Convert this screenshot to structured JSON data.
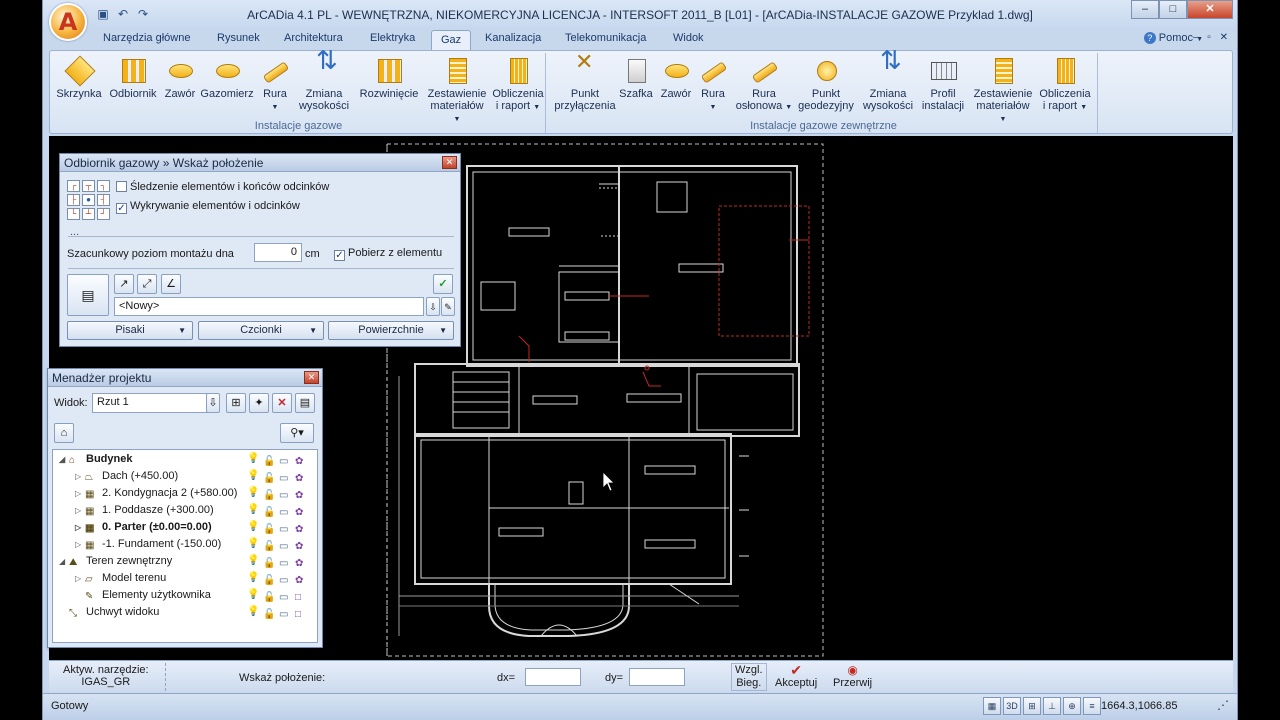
{
  "window": {
    "title": "ArCADia 4.1 PL - WEWNĘTRZNA, NIEKOMERCYJNA LICENCJA - INTERSOFT 2011_B [L01] - [ArCADia-INSTALACJE GAZOWE Przyklad 1.dwg]",
    "app_letter": "A"
  },
  "ribbon": {
    "tabs": [
      "Narzędzia główne",
      "Rysunek",
      "Architektura",
      "Elektryka",
      "Gaz",
      "Kanalizacja",
      "Telekomunikacja",
      "Widok"
    ],
    "active_tab": "Gaz",
    "help_label": "Pomoc",
    "groups": [
      {
        "title": "Instalacje gazowe",
        "buttons": [
          "Skrzynka",
          "Odbiornik",
          "Zawór",
          "Gazomierz",
          "Rura",
          "Zmiana wysokości",
          "Rozwinięcie",
          "Zestawienie materiałów",
          "Obliczenia i raport"
        ]
      },
      {
        "title": "Instalacje gazowe zewnętrzne",
        "buttons": [
          "Punkt przyłączenia",
          "Szafka",
          "Zawór",
          "Rura",
          "Rura osłonowa",
          "Punkt geodezyjny",
          "Zmiana wysokości",
          "Profil instalacji",
          "Zestawienie materiałów",
          "Obliczenia i raport"
        ]
      }
    ]
  },
  "odbiornik_panel": {
    "title": "Odbiornik gazowy » Wskaż położenie",
    "opt_tracking": "Śledzenie elementów i końców odcinków",
    "opt_detect": "Wykrywanie elementów i odcinków",
    "ellipsis": "...",
    "level_label": "Szacunkowy poziom montażu dna",
    "level_value": "0",
    "level_unit": "cm",
    "from_element": "Pobierz z elementu",
    "style_value": "<Nowy>",
    "btn_pens": "Pisaki",
    "btn_fonts": "Czcionki",
    "btn_surfaces": "Powierzchnie"
  },
  "project_manager": {
    "title": "Menadżer projektu",
    "view_label": "Widok:",
    "view_value": "Rzut 1",
    "tree": [
      {
        "label": "Budynek",
        "bold": true,
        "level": 0
      },
      {
        "label": "Dach (+450.00)",
        "level": 1
      },
      {
        "label": "2. Kondygnacja 2 (+580.00)",
        "level": 1
      },
      {
        "label": "1. Poddasze (+300.00)",
        "level": 1
      },
      {
        "label": "0. Parter (±0.00=0.00)",
        "bold": true,
        "level": 1
      },
      {
        "label": "-1. Fundament (-150.00)",
        "level": 1
      },
      {
        "label": "Teren zewnętrzny",
        "level": 0
      },
      {
        "label": "Model terenu",
        "level": 1
      },
      {
        "label": "Elementy użytkownika",
        "level": 1
      },
      {
        "label": "Uchwyt widoku",
        "level": 0
      }
    ]
  },
  "cmdbar": {
    "active_tool_label": "Aktyw. narzędzie:",
    "active_tool_value": "IGAS_GR",
    "prompt": "Wskaż położenie:",
    "dx_label": "dx=",
    "dy_label": "dy=",
    "relative_label_1": "Wzgl.",
    "relative_label_2": "Bieg.",
    "accept": "Akceptuj",
    "interrupt": "Przerwij"
  },
  "status": {
    "text": "Gotowy",
    "coords": "1664.3,1066.85"
  }
}
